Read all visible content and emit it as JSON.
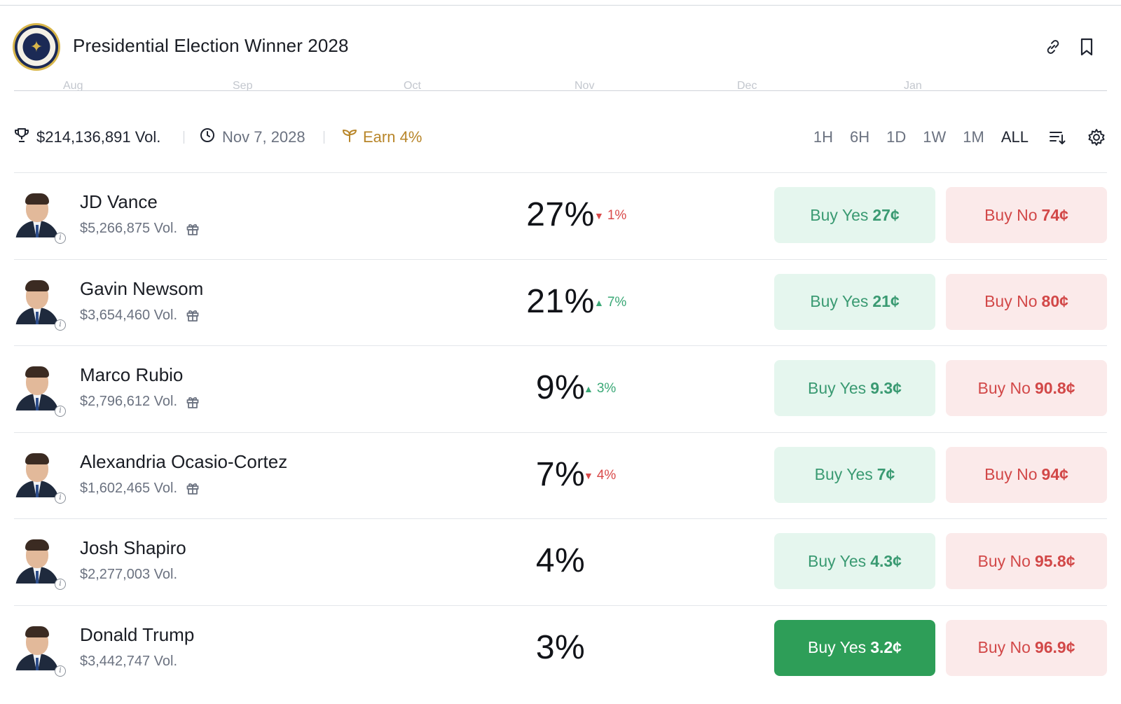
{
  "header": {
    "title": "Presidential Election Winner 2028",
    "logo": "presidential-seal",
    "icons": [
      "link-icon",
      "bookmark-icon"
    ]
  },
  "chart_axis": {
    "labels": [
      "Aug",
      "Sep",
      "Oct",
      "Nov",
      "Dec",
      "Jan"
    ]
  },
  "stats": {
    "volume": "$214,136,891 Vol.",
    "date": "Nov 7, 2028",
    "earn": "Earn 4%"
  },
  "ranges": [
    {
      "label": "1H",
      "active": false
    },
    {
      "label": "6H",
      "active": false
    },
    {
      "label": "1D",
      "active": false
    },
    {
      "label": "1W",
      "active": false
    },
    {
      "label": "1M",
      "active": false
    },
    {
      "label": "ALL",
      "active": true
    }
  ],
  "colors": {
    "yes_bg": "#e5f6ee",
    "yes_text": "#3a9a72",
    "yes_solid": "#2e9e58",
    "no_bg": "#fbeaea",
    "no_text": "#d24848",
    "earn": "#b8862a"
  },
  "candidates": [
    {
      "name": "JD Vance",
      "volume": "$5,266,875 Vol.",
      "gift": true,
      "pct": "27%",
      "change": "1%",
      "direction": "down",
      "yes_label": "Buy Yes",
      "yes_price": "27¢",
      "no_label": "Buy No",
      "no_price": "74¢",
      "yes_selected": false
    },
    {
      "name": "Gavin Newsom",
      "volume": "$3,654,460 Vol.",
      "gift": true,
      "pct": "21%",
      "change": "7%",
      "direction": "up",
      "yes_label": "Buy Yes",
      "yes_price": "21¢",
      "no_label": "Buy No",
      "no_price": "80¢",
      "yes_selected": false
    },
    {
      "name": "Marco Rubio",
      "volume": "$2,796,612 Vol.",
      "gift": true,
      "pct": "9%",
      "change": "3%",
      "direction": "up",
      "yes_label": "Buy Yes",
      "yes_price": "9.3¢",
      "no_label": "Buy No",
      "no_price": "90.8¢",
      "yes_selected": false
    },
    {
      "name": "Alexandria Ocasio-Cortez",
      "volume": "$1,602,465 Vol.",
      "gift": true,
      "pct": "7%",
      "change": "4%",
      "direction": "down",
      "yes_label": "Buy Yes",
      "yes_price": "7¢",
      "no_label": "Buy No",
      "no_price": "94¢",
      "yes_selected": false
    },
    {
      "name": "Josh Shapiro",
      "volume": "$2,277,003 Vol.",
      "gift": false,
      "pct": "4%",
      "change": "",
      "direction": "none",
      "yes_label": "Buy Yes",
      "yes_price": "4.3¢",
      "no_label": "Buy No",
      "no_price": "95.8¢",
      "yes_selected": false
    },
    {
      "name": "Donald Trump",
      "volume": "$3,442,747 Vol.",
      "gift": false,
      "pct": "3%",
      "change": "",
      "direction": "none",
      "yes_label": "Buy Yes",
      "yes_price": "3.2¢",
      "no_label": "Buy No",
      "no_price": "96.9¢",
      "yes_selected": true
    }
  ]
}
